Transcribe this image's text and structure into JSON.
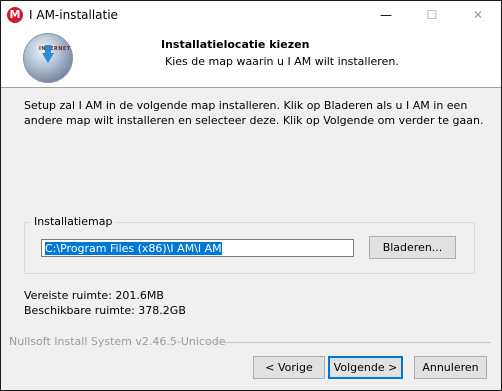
{
  "window": {
    "title": "I AM-installatie",
    "app_icon_letter": "M",
    "minimize_glyph": "—",
    "maximize_glyph": "☐",
    "close_glyph": "✕"
  },
  "header": {
    "title": "Installatielocatie kiezen",
    "subtitle": "Kies de map waarin u I AM wilt installeren.",
    "logo_label": "INTERNET",
    "logo_icon": "download-globe-icon"
  },
  "body": {
    "intro": "Setup zal I AM in de volgende map installeren. Klik op Bladeren als u I AM in een andere map wilt installeren en selecteer deze. Klik op Volgende om verder te gaan."
  },
  "install_folder": {
    "label": "Installatiemap",
    "path": "C:\\Program Files (x86)\\I AM\\I AM",
    "browse_label": "Bladeren..."
  },
  "space": {
    "required": "Vereiste ruimte: 201.6MB",
    "available": "Beschikbare ruimte: 378.2GB"
  },
  "footer": {
    "nsis": "Nullsoft Install System v2.46.5-Unicode",
    "prev_label": "< Vorige",
    "next_label": "Volgende >",
    "cancel_label": "Annuleren"
  },
  "colors": {
    "selection": "#0078d7",
    "app_icon": "#d6192a"
  }
}
